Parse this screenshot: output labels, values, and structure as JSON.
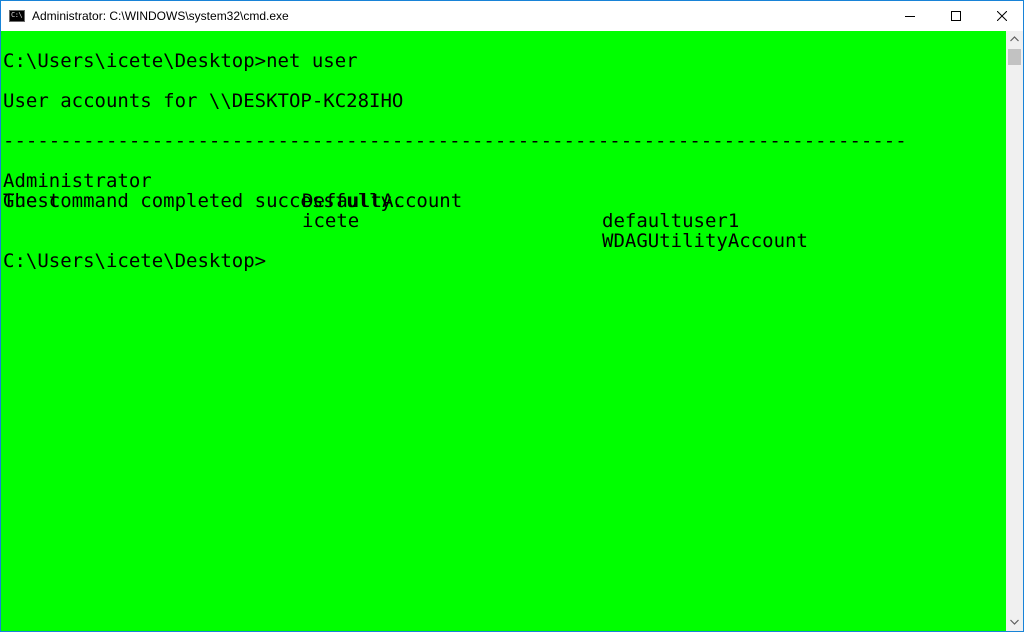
{
  "window": {
    "title": "Administrator: C:\\WINDOWS\\system32\\cmd.exe",
    "icon": "cmd-icon",
    "icon_text": "C:\\"
  },
  "caption_buttons": {
    "minimize": "minimize-icon",
    "maximize": "maximize-icon",
    "close": "close-icon"
  },
  "colors": {
    "console_background": "#00ff00",
    "console_text": "#000000",
    "window_border": "#1883d7"
  },
  "console": {
    "command_line": "C:\\Users\\icete\\Desktop>net user",
    "accounts_header": "User accounts for \\\\DESKTOP-KC28IHO",
    "separator": "-------------------------------------------------------------------------------",
    "accounts": [
      [
        "Administrator",
        "DefaultAccount",
        "defaultuser1"
      ],
      [
        "Guest",
        "icete",
        "WDAGUtilityAccount"
      ]
    ],
    "result": "The command completed successfully.",
    "prompt": "C:\\Users\\icete\\Desktop>"
  }
}
